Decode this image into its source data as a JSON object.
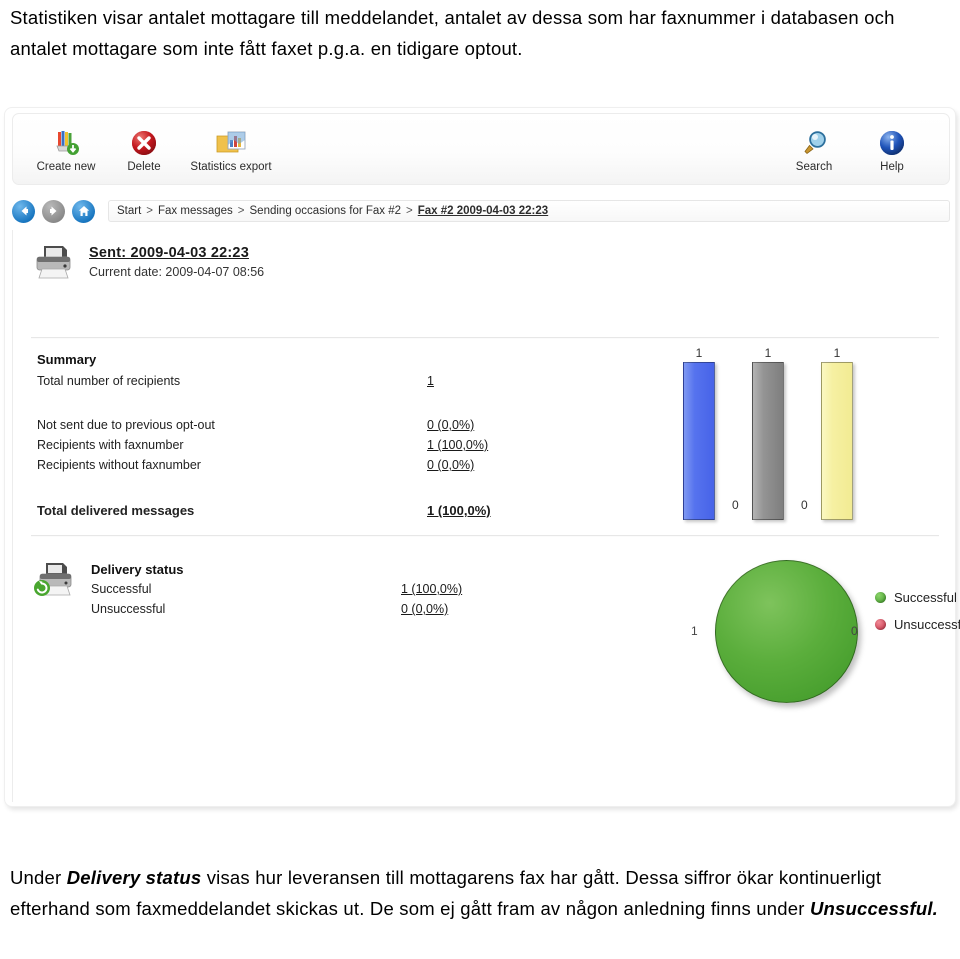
{
  "intro_text_parts": {
    "full": "Statistiken visar antalet mottagare till meddelandet, antalet av dessa som har faxnummer i databasen och antalet mottagare som inte fått faxet p.g.a. en tidigare optout."
  },
  "outro_text_parts": {
    "a": "Under ",
    "b": "Delivery status",
    "c": " visas hur leveransen till mottagarens fax har gått. Dessa siffror ökar kontinuerligt efterhand som faxmeddelandet skickas ut. De som ej gått fram av någon anledning finns under ",
    "d": "Unsuccessful."
  },
  "toolbar": {
    "buttons": [
      {
        "label": "Create new",
        "icon": "create-new-icon"
      },
      {
        "label": "Delete",
        "icon": "delete-icon"
      },
      {
        "label": "Statistics export",
        "icon": "statistics-export-icon"
      }
    ],
    "right_buttons": [
      {
        "label": "Search",
        "icon": "search-icon"
      },
      {
        "label": "Help",
        "icon": "help-icon"
      }
    ]
  },
  "navigation": {
    "back_title": "Back",
    "forward_title": "Forward",
    "home_title": "Home"
  },
  "breadcrumb": {
    "items": [
      "Start",
      "Fax messages",
      "Sending occasions for Fax #2",
      "Fax #2 2009-04-03 22:23"
    ],
    "separator": ">"
  },
  "header": {
    "sent_label": "Sent: 2009-04-03 22:23",
    "current_date": "Current date: 2009-04-07 08:56"
  },
  "summary": {
    "title": "Summary",
    "total_recipients_label": "Total number of recipients",
    "total_recipients_value": "1",
    "rows": [
      {
        "label": "Not sent due to previous opt-out",
        "value": "0 (0,0%)"
      },
      {
        "label": "Recipients with faxnumber",
        "value": "1 (100,0%)"
      },
      {
        "label": "Recipients without faxnumber",
        "value": "0 (0,0%)"
      }
    ],
    "total_label": "Total delivered messages",
    "total_value": "1 (100,0%)"
  },
  "delivery": {
    "title": "Delivery status",
    "rows": [
      {
        "label": "Successful",
        "value": "1 (100,0%)"
      },
      {
        "label": "Unsuccessful",
        "value": "0 (0,0%)"
      }
    ]
  },
  "chart_data": [
    {
      "type": "bar",
      "title": "",
      "categories": [
        "Total number of recipients",
        "Not sent due to previous opt-out",
        "Recipients with faxnumber",
        "Recipients without faxnumber",
        "Total delivered messages"
      ],
      "values": [
        1,
        0,
        1,
        0,
        1
      ],
      "data_labels": [
        "1",
        "0",
        "1",
        "0",
        "1"
      ],
      "colors": [
        "#5a77ee",
        "#8f8f8f",
        "#f6f2a0"
      ],
      "bar_colors_by_index": [
        "#5a77ee",
        null,
        "#8f8f8f",
        null,
        "#f6f2a0"
      ],
      "xlabel": "",
      "ylabel": "",
      "ylim": [
        0,
        1
      ],
      "grid": false,
      "legend": "none"
    },
    {
      "type": "pie",
      "title": "",
      "labels": [
        "Successful",
        "Unsuccessful"
      ],
      "values": [
        1,
        0
      ],
      "data_labels": [
        "1",
        "0"
      ],
      "colors": [
        "#5bae3c",
        "#dc4a5d"
      ],
      "legend": "right"
    }
  ]
}
